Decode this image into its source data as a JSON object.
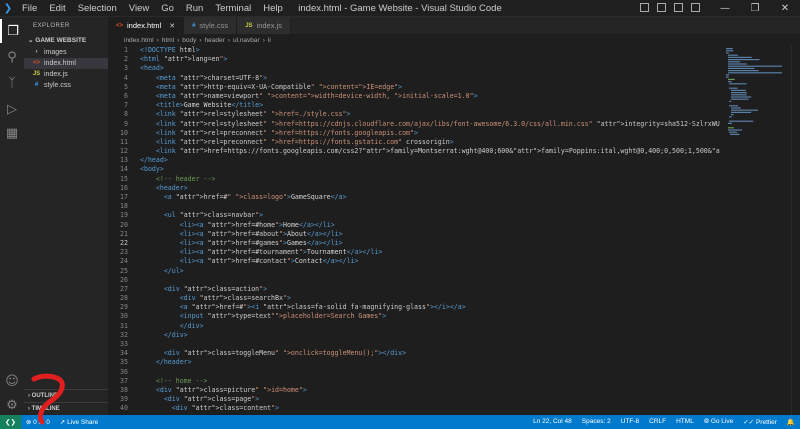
{
  "titlebar": {
    "menu": [
      "File",
      "Edit",
      "Selection",
      "View",
      "Go",
      "Run",
      "Terminal",
      "Help"
    ],
    "title": "index.html - Game Website - Visual Studio Code"
  },
  "activity": {
    "icons": [
      "files-icon",
      "search-icon",
      "source-control-icon",
      "run-debug-icon",
      "extensions-icon",
      "account-icon",
      "settings-gear-icon"
    ]
  },
  "sidebar": {
    "title": "EXPLORER",
    "folder": "GAME WEBSITE",
    "items": [
      {
        "label": "images",
        "type": "folder"
      },
      {
        "label": "index.html",
        "type": "html"
      },
      {
        "label": "index.js",
        "type": "js"
      },
      {
        "label": "style.css",
        "type": "css"
      }
    ],
    "outline": "OUTLINE",
    "timeline": "TIMELINE"
  },
  "tabs": [
    {
      "label": "index.html",
      "icon": "html",
      "active": true
    },
    {
      "label": "style.css",
      "icon": "css",
      "active": false
    },
    {
      "label": "index.js",
      "icon": "js",
      "active": false
    }
  ],
  "breadcrumb": [
    "index.html",
    "html",
    "body",
    "header",
    "ul.navbar",
    "li"
  ],
  "code_lines": [
    "<!DOCTYPE html>",
    "<html lang=\"en\">",
    "<head>",
    "    <meta charset=\"UTF-8\">",
    "    <meta http-equiv=\"X-UA-Compatible\" content=\"IE=edge\">",
    "    <meta name=\"viewport\" content=\"width=device-width, initial-scale=1.0\">",
    "    <title>Game Website</title>",
    "    <link rel=\"stylesheet\" href=\"./style.css\">",
    "    <link rel=\"stylesheet\" href=\"https://cdnjs.cloudflare.com/ajax/libs/font-awesome/6.3.0/css/all.min.css\" integrity=\"sha512-SzlrxWUlpfuzQ+pcUCosxcglQRNAq",
    "    <link rel=\"preconnect\" href=\"https://fonts.googleapis.com\">",
    "    <link rel=\"preconnect\" href=\"https://fonts.gstatic.com\" crossorigin>",
    "    <link href=\"https://fonts.googleapis.com/css2?family=Montserrat:wght@400;600&family=Poppins:ital,wght@0,400;0,500;1,500&display=swap\" rel=\"stylesheet\">",
    "</head>",
    "<body>",
    "    <!-- header -->",
    "    <header>",
    "      <a href=\"#\" class=\"logo\">GameSquare</a>",
    "",
    "      <ul class=\"navbar\">",
    "          <li><a href=\"#home\">Home</a></li>",
    "          <li><a href=\"#about\">About</a></li>",
    "          <li><a href=\"#games\">Games</a></li>",
    "          <li><a href=\"#tournament\">Tournament</a></li>",
    "          <li><a href=\"#contact\">Contact</a></li>",
    "      </ul>",
    "",
    "      <div class=\"action\">",
    "          <div class=\"searchBx\">",
    "          <a href=\"#\"><i class=\"fa-solid fa-magnifying-glass\"></i></a>",
    "          <input type=\"text\"placeholder=\"Search Games\">",
    "          </div>",
    "      </div>",
    "",
    "      <div class=\"toggleMenu\" onclick=\"toggleMenu();\"></div>",
    "    </header>",
    "",
    "    <!-- home -->",
    "    <div class=\"picture\" id=\"home\">",
    "      <div class=\"page\">",
    "        <div class=\"content\">"
  ],
  "current_line": 22,
  "statusbar": {
    "errors": "0",
    "warnings": "0",
    "live_share": "Live Share",
    "position": "Ln 22, Col 48",
    "spaces": "Spaces: 2",
    "encoding": "UTF-8",
    "eol": "CRLF",
    "language": "HTML",
    "go_live": "Go Live",
    "prettier": "Prettier"
  },
  "colors": {
    "accent": "#007acc",
    "annotation": "#e02020"
  }
}
